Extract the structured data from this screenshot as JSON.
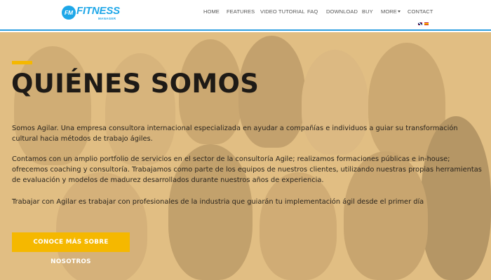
{
  "header": {
    "logo": {
      "mark": "FM",
      "word": "FITNESS",
      "sub": "MANAGER"
    },
    "nav": [
      {
        "label": "HOME"
      },
      {
        "label": "FEATURES"
      },
      {
        "label": "VIDEO TUTORIAL"
      },
      {
        "label": "FAQ"
      },
      {
        "label": "DOWNLOAD"
      },
      {
        "label": "BUY"
      },
      {
        "label": "MORE"
      },
      {
        "label": "CONTACT"
      }
    ],
    "accent_color": "#2f9fe0"
  },
  "hero": {
    "title": "QUIÉNES SOMOS",
    "paragraphs": [
      "Somos Agilar. Una empresa consultora internacional especializada en ayudar a compañías e individuos a guiar su transformación cultural hacia métodos de trabajo ágiles.",
      "Contamos con un amplio portfolio de servicios en el sector de la consultoría Agile; realizamos formaciones públicas e in-house; ofrecemos coaching y consultoría. Trabajamos como parte de los equipos de nuestros clientes, utilizando nuestras propias herramientas de evaluación y modelos de madurez desarrollados durante nuestros años de experiencia.",
      "Trabajar con Agilar es trabajar con profesionales de la industria que guiarán tu implementación ágil desde el primer día"
    ],
    "cta_label": "CONOCE MÁS SOBRE NOSOTROS",
    "accent_color": "#f5b800"
  }
}
